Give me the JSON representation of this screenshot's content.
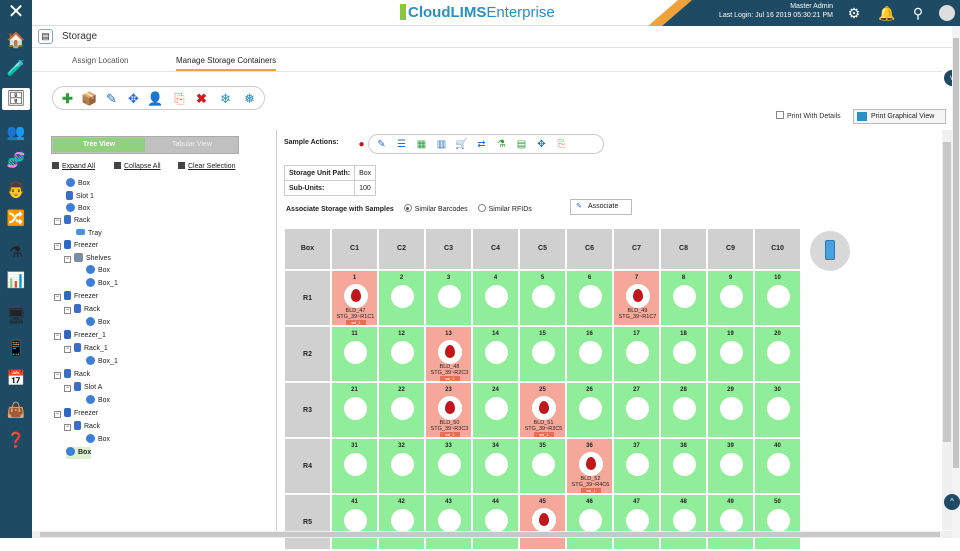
{
  "app": {
    "logo_text": "CloudLIMS",
    "logo_suffix": "Enterprise",
    "user_name": "Master Admin",
    "last_login": "Last Login: Jul 16 2019 05:30:21 PM",
    "close_glyph": "✕"
  },
  "page": {
    "title": "Storage",
    "tabs": [
      {
        "label": "Assign Location"
      },
      {
        "label": "Manage Storage Containers"
      }
    ]
  },
  "print": {
    "with_details_label": "Print With Details",
    "graphical_label": "Print Graphical View"
  },
  "tree_panel": {
    "tree_view_label": "Tree View",
    "tabular_view_label": "Tabular View",
    "expand_all": "Expand All",
    "collapse_all": "Collapse All",
    "clear_selection": "Clear Selection",
    "nodes": [
      {
        "label": "Box"
      },
      {
        "label": "Slot 1"
      },
      {
        "label": "Box"
      },
      {
        "label": "Rack"
      },
      {
        "label": "Tray"
      },
      {
        "label": "Freezer"
      },
      {
        "label": "Shelves"
      },
      {
        "label": "Box"
      },
      {
        "label": "Box_1"
      },
      {
        "label": "Freezer"
      },
      {
        "label": "Rack"
      },
      {
        "label": "Box"
      },
      {
        "label": "Freezer_1"
      },
      {
        "label": "Rack_1"
      },
      {
        "label": "Box_1"
      },
      {
        "label": "Rack"
      },
      {
        "label": "Slot A"
      },
      {
        "label": "Box"
      },
      {
        "label": "Freezer"
      },
      {
        "label": "Rack"
      },
      {
        "label": "Box"
      },
      {
        "label": "Box"
      }
    ]
  },
  "main": {
    "sample_actions_label": "Sample Actions:",
    "storage_unit_path_label": "Storage Unit Path:",
    "storage_unit_path_value": "Box",
    "sub_units_label": "Sub-Units:",
    "sub_units_value": "100",
    "associate_label": "Associate Storage with Samples",
    "similar_barcodes": "Similar Barcodes",
    "similar_rfids": "Similar RFIDs",
    "associate_button": "Associate",
    "grid": {
      "corner": "Box",
      "columns": [
        "C1",
        "C2",
        "C3",
        "C4",
        "C5",
        "C6",
        "C7",
        "C8",
        "C9",
        "C10"
      ],
      "rows": [
        {
          "label": "R1",
          "slots": [
            {
              "n": "1",
              "filled": true,
              "id": "BLD_47",
              "loc": "STG_39~R1C1",
              "tag": "ssl_1"
            },
            {
              "n": "2"
            },
            {
              "n": "3"
            },
            {
              "n": "4"
            },
            {
              "n": "5"
            },
            {
              "n": "6"
            },
            {
              "n": "7",
              "filled": true,
              "id": "BLD_49",
              "loc": "STG_39~R1C7",
              "tag": ""
            },
            {
              "n": "8"
            },
            {
              "n": "9"
            },
            {
              "n": "10"
            }
          ]
        },
        {
          "label": "R2",
          "slots": [
            {
              "n": "11"
            },
            {
              "n": "12"
            },
            {
              "n": "13",
              "filled": true,
              "id": "BLD_48",
              "loc": "STG_39~R2C3",
              "tag": "ssl_1"
            },
            {
              "n": "14"
            },
            {
              "n": "15"
            },
            {
              "n": "16"
            },
            {
              "n": "17"
            },
            {
              "n": "18"
            },
            {
              "n": "19"
            },
            {
              "n": "20"
            }
          ]
        },
        {
          "label": "R3",
          "slots": [
            {
              "n": "21"
            },
            {
              "n": "22"
            },
            {
              "n": "23",
              "filled": true,
              "id": "BLD_50",
              "loc": "STG_39~R3C3",
              "tag": "ssl_1"
            },
            {
              "n": "24"
            },
            {
              "n": "25",
              "filled": true,
              "id": "BLD_51",
              "loc": "STG_39~R3C5",
              "tag": "ssl_1"
            },
            {
              "n": "26"
            },
            {
              "n": "27"
            },
            {
              "n": "28"
            },
            {
              "n": "29"
            },
            {
              "n": "30"
            }
          ]
        },
        {
          "label": "R4",
          "slots": [
            {
              "n": "31"
            },
            {
              "n": "32"
            },
            {
              "n": "33"
            },
            {
              "n": "34"
            },
            {
              "n": "35"
            },
            {
              "n": "36",
              "filled": true,
              "id": "BLD_52",
              "loc": "STG_39~R4C6",
              "tag": "ssl_1"
            },
            {
              "n": "37"
            },
            {
              "n": "38"
            },
            {
              "n": "39"
            },
            {
              "n": "40"
            }
          ]
        },
        {
          "label": "R5",
          "slots": [
            {
              "n": "41"
            },
            {
              "n": "42"
            },
            {
              "n": "43"
            },
            {
              "n": "44"
            },
            {
              "n": "45",
              "filled": true,
              "id": "",
              "loc": "",
              "tag": ""
            },
            {
              "n": "46"
            },
            {
              "n": "47"
            },
            {
              "n": "48"
            },
            {
              "n": "49"
            },
            {
              "n": "50"
            }
          ]
        }
      ]
    }
  },
  "colors": {
    "brand_dark": "#1e4a63",
    "accent_orange": "#f0a23a",
    "empty_slot": "#90ee9a",
    "filled_slot": "#f5a89a"
  }
}
